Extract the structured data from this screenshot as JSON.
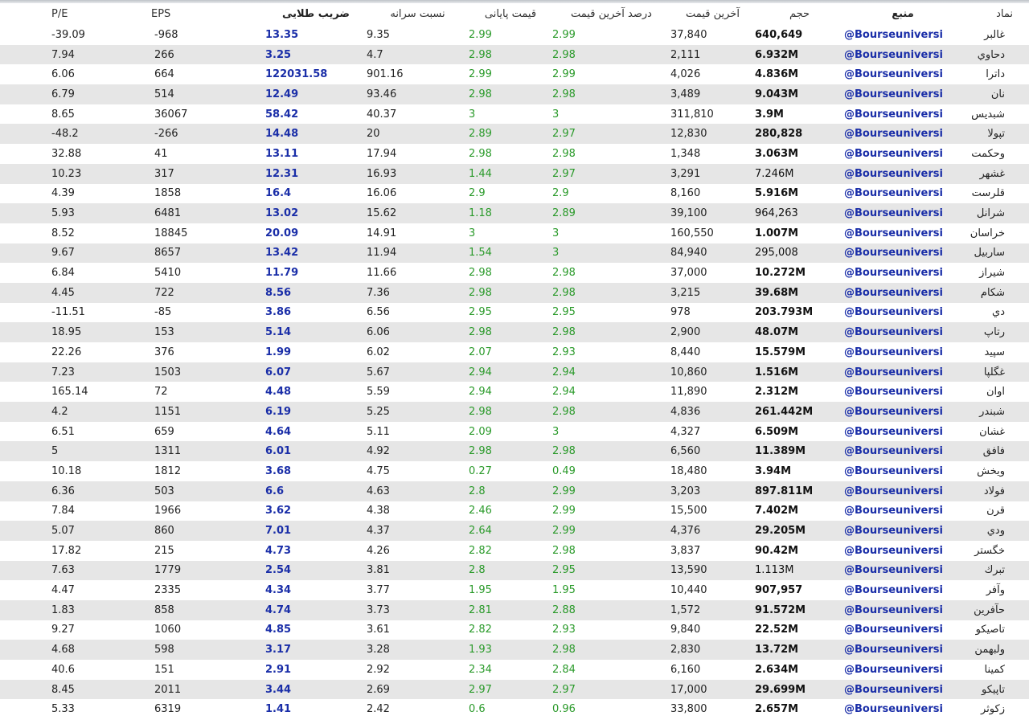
{
  "headers": {
    "pe": "P/E",
    "eps": "EPS",
    "zarib": "ضریب طلایی",
    "nesbat": "نسبت سرانه",
    "payani": "قیمت پایانی",
    "darsad": "درصد آخرین قیمت",
    "akhar": "آخرین قیمت",
    "hajm": "حجم",
    "manba": "منبع",
    "namad": "نماد"
  },
  "rows": [
    {
      "pe": "-39.09",
      "eps": "-968",
      "zarib": "13.35",
      "nesbat": "9.35",
      "payani": "2.99",
      "darsad": "2.99",
      "akhar": "37,840",
      "hajm": "640,649",
      "hajm_bold": true,
      "manba": "@Bourseuniversi",
      "namad": "غالبر"
    },
    {
      "pe": "7.94",
      "eps": "266",
      "zarib": "3.25",
      "nesbat": "4.7",
      "payani": "2.98",
      "darsad": "2.98",
      "akhar": "2,111",
      "hajm": "6.932M",
      "hajm_bold": true,
      "manba": "@Bourseuniversi",
      "namad": "دحاوي"
    },
    {
      "pe": "6.06",
      "eps": "664",
      "zarib": "122031.58",
      "nesbat": "901.16",
      "payani": "2.99",
      "darsad": "2.99",
      "akhar": "4,026",
      "hajm": "4.836M",
      "hajm_bold": true,
      "manba": "@Bourseuniversi",
      "namad": "داترا"
    },
    {
      "pe": "6.79",
      "eps": "514",
      "zarib": "12.49",
      "nesbat": "93.46",
      "payani": "2.98",
      "darsad": "2.98",
      "akhar": "3,489",
      "hajm": "9.043M",
      "hajm_bold": true,
      "manba": "@Bourseuniversi",
      "namad": "نان"
    },
    {
      "pe": "8.65",
      "eps": "36067",
      "zarib": "58.42",
      "nesbat": "40.37",
      "payani": "3",
      "darsad": "3",
      "akhar": "311,810",
      "hajm": "3.9M",
      "hajm_bold": true,
      "manba": "@Bourseuniversi",
      "namad": "شبديس"
    },
    {
      "pe": "-48.2",
      "eps": "-266",
      "zarib": "14.48",
      "nesbat": "20",
      "payani": "2.89",
      "darsad": "2.97",
      "akhar": "12,830",
      "hajm": "280,828",
      "hajm_bold": true,
      "manba": "@Bourseuniversi",
      "namad": "تپولا"
    },
    {
      "pe": "32.88",
      "eps": "41",
      "zarib": "13.11",
      "nesbat": "17.94",
      "payani": "2.98",
      "darsad": "2.98",
      "akhar": "1,348",
      "hajm": "3.063M",
      "hajm_bold": true,
      "manba": "@Bourseuniversi",
      "namad": "وحكمت"
    },
    {
      "pe": "10.23",
      "eps": "317",
      "zarib": "12.31",
      "nesbat": "16.93",
      "payani": "1.44",
      "darsad": "2.97",
      "akhar": "3,291",
      "hajm": "7.246M",
      "hajm_bold": false,
      "manba": "@Bourseuniversi",
      "namad": "غشهر"
    },
    {
      "pe": "4.39",
      "eps": "1858",
      "zarib": "16.4",
      "nesbat": "16.06",
      "payani": "2.9",
      "darsad": "2.9",
      "akhar": "8,160",
      "hajm": "5.916M",
      "hajm_bold": true,
      "manba": "@Bourseuniversi",
      "namad": "قلرست"
    },
    {
      "pe": "5.93",
      "eps": "6481",
      "zarib": "13.02",
      "nesbat": "15.62",
      "payani": "1.18",
      "darsad": "2.89",
      "akhar": "39,100",
      "hajm": "964,263",
      "hajm_bold": false,
      "manba": "@Bourseuniversi",
      "namad": "شرانل"
    },
    {
      "pe": "8.52",
      "eps": "18845",
      "zarib": "20.09",
      "nesbat": "14.91",
      "payani": "3",
      "darsad": "3",
      "akhar": "160,550",
      "hajm": "1.007M",
      "hajm_bold": true,
      "manba": "@Bourseuniversi",
      "namad": "خراسان"
    },
    {
      "pe": "9.67",
      "eps": "8657",
      "zarib": "13.42",
      "nesbat": "11.94",
      "payani": "1.54",
      "darsad": "3",
      "akhar": "84,940",
      "hajm": "295,008",
      "hajm_bold": false,
      "manba": "@Bourseuniversi",
      "namad": "ساربيل"
    },
    {
      "pe": "6.84",
      "eps": "5410",
      "zarib": "11.79",
      "nesbat": "11.66",
      "payani": "2.98",
      "darsad": "2.98",
      "akhar": "37,000",
      "hajm": "10.272M",
      "hajm_bold": true,
      "manba": "@Bourseuniversi",
      "namad": "شيراز"
    },
    {
      "pe": "4.45",
      "eps": "722",
      "zarib": "8.56",
      "nesbat": "7.36",
      "payani": "2.98",
      "darsad": "2.98",
      "akhar": "3,215",
      "hajm": "39.68M",
      "hajm_bold": true,
      "manba": "@Bourseuniversi",
      "namad": "شكام"
    },
    {
      "pe": "-11.51",
      "eps": "-85",
      "zarib": "3.86",
      "nesbat": "6.56",
      "payani": "2.95",
      "darsad": "2.95",
      "akhar": "978",
      "hajm": "203.793M",
      "hajm_bold": true,
      "manba": "@Bourseuniversi",
      "namad": "دي"
    },
    {
      "pe": "18.95",
      "eps": "153",
      "zarib": "5.14",
      "nesbat": "6.06",
      "payani": "2.98",
      "darsad": "2.98",
      "akhar": "2,900",
      "hajm": "48.07M",
      "hajm_bold": true,
      "manba": "@Bourseuniversi",
      "namad": "رتاپ"
    },
    {
      "pe": "22.26",
      "eps": "376",
      "zarib": "1.99",
      "nesbat": "6.02",
      "payani": "2.07",
      "darsad": "2.93",
      "akhar": "8,440",
      "hajm": "15.579M",
      "hajm_bold": true,
      "manba": "@Bourseuniversi",
      "namad": "سپيد"
    },
    {
      "pe": "7.23",
      "eps": "1503",
      "zarib": "6.07",
      "nesbat": "5.67",
      "payani": "2.94",
      "darsad": "2.94",
      "akhar": "10,860",
      "hajm": "1.516M",
      "hajm_bold": true,
      "manba": "@Bourseuniversi",
      "namad": "غگلپا"
    },
    {
      "pe": "165.14",
      "eps": "72",
      "zarib": "4.48",
      "nesbat": "5.59",
      "payani": "2.94",
      "darsad": "2.94",
      "akhar": "11,890",
      "hajm": "2.312M",
      "hajm_bold": true,
      "manba": "@Bourseuniversi",
      "namad": "اوان"
    },
    {
      "pe": "4.2",
      "eps": "1151",
      "zarib": "6.19",
      "nesbat": "5.25",
      "payani": "2.98",
      "darsad": "2.98",
      "akhar": "4,836",
      "hajm": "261.442M",
      "hajm_bold": true,
      "manba": "@Bourseuniversi",
      "namad": "شبندر"
    },
    {
      "pe": "6.51",
      "eps": "659",
      "zarib": "4.64",
      "nesbat": "5.11",
      "payani": "2.09",
      "darsad": "3",
      "akhar": "4,327",
      "hajm": "6.509M",
      "hajm_bold": true,
      "manba": "@Bourseuniversi",
      "namad": "غشان"
    },
    {
      "pe": "5",
      "eps": "1311",
      "zarib": "6.01",
      "nesbat": "4.92",
      "payani": "2.98",
      "darsad": "2.98",
      "akhar": "6,560",
      "hajm": "11.389M",
      "hajm_bold": true,
      "manba": "@Bourseuniversi",
      "namad": "فافق"
    },
    {
      "pe": "10.18",
      "eps": "1812",
      "zarib": "3.68",
      "nesbat": "4.75",
      "payani": "0.27",
      "darsad": "0.49",
      "akhar": "18,480",
      "hajm": "3.94M",
      "hajm_bold": true,
      "manba": "@Bourseuniversi",
      "namad": "ويخش"
    },
    {
      "pe": "6.36",
      "eps": "503",
      "zarib": "6.6",
      "nesbat": "4.63",
      "payani": "2.8",
      "darsad": "2.99",
      "akhar": "3,203",
      "hajm": "897.811M",
      "hajm_bold": true,
      "manba": "@Bourseuniversi",
      "namad": "فولاد"
    },
    {
      "pe": "7.84",
      "eps": "1966",
      "zarib": "3.62",
      "nesbat": "4.38",
      "payani": "2.46",
      "darsad": "2.99",
      "akhar": "15,500",
      "hajm": "7.402M",
      "hajm_bold": true,
      "manba": "@Bourseuniversi",
      "namad": "قرن"
    },
    {
      "pe": "5.07",
      "eps": "860",
      "zarib": "7.01",
      "nesbat": "4.37",
      "payani": "2.64",
      "darsad": "2.99",
      "akhar": "4,376",
      "hajm": "29.205M",
      "hajm_bold": true,
      "manba": "@Bourseuniversi",
      "namad": "ودي"
    },
    {
      "pe": "17.82",
      "eps": "215",
      "zarib": "4.73",
      "nesbat": "4.26",
      "payani": "2.82",
      "darsad": "2.98",
      "akhar": "3,837",
      "hajm": "90.42M",
      "hajm_bold": true,
      "manba": "@Bourseuniversi",
      "namad": "خگستر"
    },
    {
      "pe": "7.63",
      "eps": "1779",
      "zarib": "2.54",
      "nesbat": "3.81",
      "payani": "2.8",
      "darsad": "2.95",
      "akhar": "13,590",
      "hajm": "1.113M",
      "hajm_bold": false,
      "manba": "@Bourseuniversi",
      "namad": "تبرك"
    },
    {
      "pe": "4.47",
      "eps": "2335",
      "zarib": "4.34",
      "nesbat": "3.77",
      "payani": "1.95",
      "darsad": "1.95",
      "akhar": "10,440",
      "hajm": "907,957",
      "hajm_bold": true,
      "manba": "@Bourseuniversi",
      "namad": "وآفر"
    },
    {
      "pe": "1.83",
      "eps": "858",
      "zarib": "4.74",
      "nesbat": "3.73",
      "payani": "2.81",
      "darsad": "2.88",
      "akhar": "1,572",
      "hajm": "91.572M",
      "hajm_bold": true,
      "manba": "@Bourseuniversi",
      "namad": "حآفرين"
    },
    {
      "pe": "9.27",
      "eps": "1060",
      "zarib": "4.85",
      "nesbat": "3.61",
      "payani": "2.82",
      "darsad": "2.93",
      "akhar": "9,840",
      "hajm": "22.52M",
      "hajm_bold": true,
      "manba": "@Bourseuniversi",
      "namad": "تاصيكو"
    },
    {
      "pe": "4.68",
      "eps": "598",
      "zarib": "3.17",
      "nesbat": "3.28",
      "payani": "1.93",
      "darsad": "2.98",
      "akhar": "2,830",
      "hajm": "13.72M",
      "hajm_bold": true,
      "manba": "@Bourseuniversi",
      "namad": "ولبهمن"
    },
    {
      "pe": "40.6",
      "eps": "151",
      "zarib": "2.91",
      "nesbat": "2.92",
      "payani": "2.34",
      "darsad": "2.84",
      "akhar": "6,160",
      "hajm": "2.634M",
      "hajm_bold": true,
      "manba": "@Bourseuniversi",
      "namad": "كمينا"
    },
    {
      "pe": "8.45",
      "eps": "2011",
      "zarib": "3.44",
      "nesbat": "2.69",
      "payani": "2.97",
      "darsad": "2.97",
      "akhar": "17,000",
      "hajm": "29.699M",
      "hajm_bold": true,
      "manba": "@Bourseuniversi",
      "namad": "تاپيكو"
    },
    {
      "pe": "5.33",
      "eps": "6319",
      "zarib": "1.41",
      "nesbat": "2.42",
      "payani": "0.6",
      "darsad": "0.96",
      "akhar": "33,800",
      "hajm": "2.657M",
      "hajm_bold": true,
      "manba": "@Bourseuniversi",
      "namad": "زكوثر"
    }
  ]
}
